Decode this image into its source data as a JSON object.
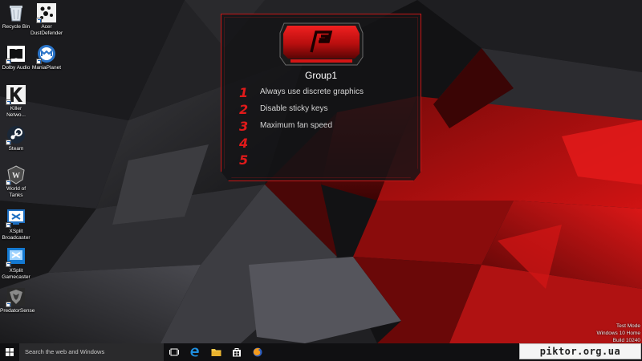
{
  "desktop": {
    "icons": [
      {
        "label": "Recycle Bin",
        "icon": "recycle-bin-icon"
      },
      {
        "label": "Acer DustDefender",
        "icon": "dustdefender-icon"
      },
      {
        "label": "Dolby Audio",
        "icon": "dolby-audio-icon"
      },
      {
        "label": "ManiaPlanet",
        "icon": "maniaplanet-icon"
      },
      {
        "label": "Killer Netwo...",
        "icon": "killer-network-icon"
      },
      {
        "label": "Steam",
        "icon": "steam-icon"
      },
      {
        "label": "World of Tanks",
        "icon": "world-of-tanks-icon"
      },
      {
        "label": "XSplit Broadcaster",
        "icon": "xsplit-broadcaster-icon"
      },
      {
        "label": "XSplit Gamecaster",
        "icon": "xsplit-gamecaster-icon"
      },
      {
        "label": "PredatorSense",
        "icon": "predatorsense-icon"
      }
    ]
  },
  "panel": {
    "logo": "predator-p-icon",
    "group_title": "Group1",
    "slots": [
      {
        "number": "1",
        "label": "Always use discrete graphics"
      },
      {
        "number": "2",
        "label": "Disable sticky keys"
      },
      {
        "number": "3",
        "label": "Maximum fan speed"
      },
      {
        "number": "4",
        "label": ""
      },
      {
        "number": "5",
        "label": ""
      }
    ],
    "accent_color": "#c81717"
  },
  "system_watermark": {
    "line1": "Test Mode",
    "line2": "Windows 10 Home",
    "line3": "Build 10240"
  },
  "taskbar": {
    "search_placeholder": "Search the web and Windows",
    "buttons": [
      "start-icon",
      "task-view-icon",
      "edge-icon",
      "file-explorer-icon",
      "store-icon",
      "firefox-icon"
    ]
  },
  "watermark_site": "piktor.org.ua"
}
